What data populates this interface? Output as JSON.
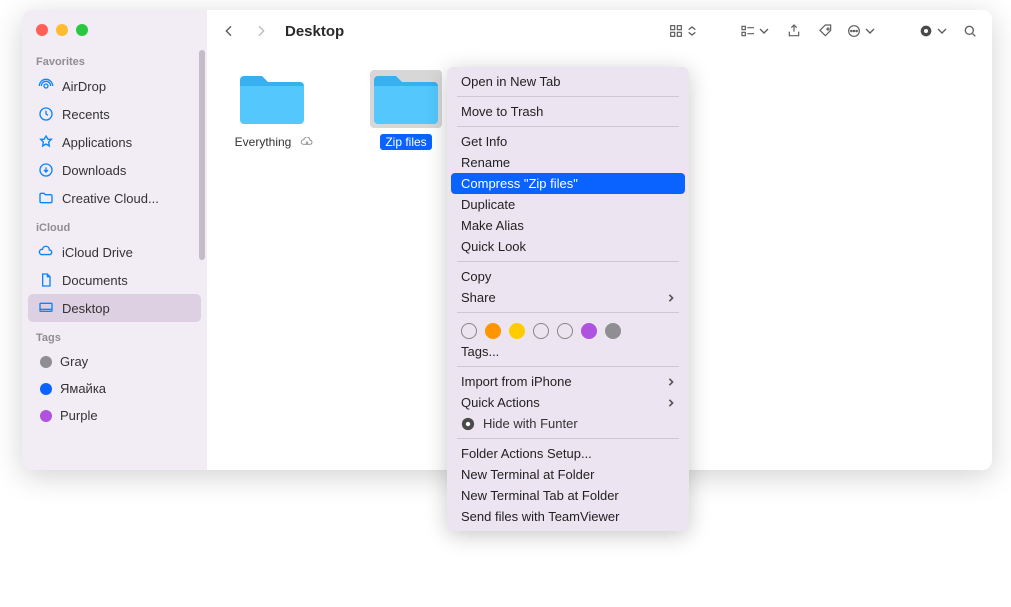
{
  "window": {
    "traffic": {
      "close": "close",
      "minimize": "minimize",
      "zoom": "zoom"
    }
  },
  "sidebar": {
    "sections": {
      "favorites": {
        "title": "Favorites",
        "items": [
          "AirDrop",
          "Recents",
          "Applications",
          "Downloads",
          "Creative Cloud..."
        ]
      },
      "icloud": {
        "title": "iCloud",
        "items": [
          "iCloud Drive",
          "Documents",
          "Desktop"
        ]
      },
      "tags": {
        "title": "Tags",
        "items": [
          {
            "label": "Gray",
            "color": "#8e8e93"
          },
          {
            "label": "Ямайка",
            "color": "#0a63ff"
          },
          {
            "label": "Purple",
            "color": "#af52de"
          }
        ]
      }
    },
    "selected": "Desktop"
  },
  "toolbar": {
    "title": "Desktop"
  },
  "files": [
    {
      "name": "Everything",
      "cloud": true,
      "selected": false
    },
    {
      "name": "Zip files",
      "cloud": false,
      "selected": true
    }
  ],
  "context_menu": {
    "groups": [
      [
        "Open in New Tab"
      ],
      [
        "Move to Trash"
      ],
      [
        "Get Info",
        "Rename",
        "Compress \"Zip files\"",
        "Duplicate",
        "Make Alias",
        "Quick Look"
      ],
      [
        "Copy",
        "Share"
      ]
    ],
    "highlighted": "Compress \"Zip files\"",
    "share_has_submenu": true,
    "tag_colors": [
      "",
      "#ff9500",
      "#ffcc00",
      "",
      "",
      "#af52de",
      "#8e8e93"
    ],
    "tags_label": "Tags...",
    "lower": [
      {
        "label": "Import from iPhone",
        "submenu": true
      },
      {
        "label": "Quick Actions",
        "submenu": true
      }
    ],
    "funter": {
      "label": "Hide with Funter"
    },
    "bottom": [
      "Folder Actions Setup...",
      "New Terminal at Folder",
      "New Terminal Tab at Folder",
      "Send files with TeamViewer"
    ]
  }
}
